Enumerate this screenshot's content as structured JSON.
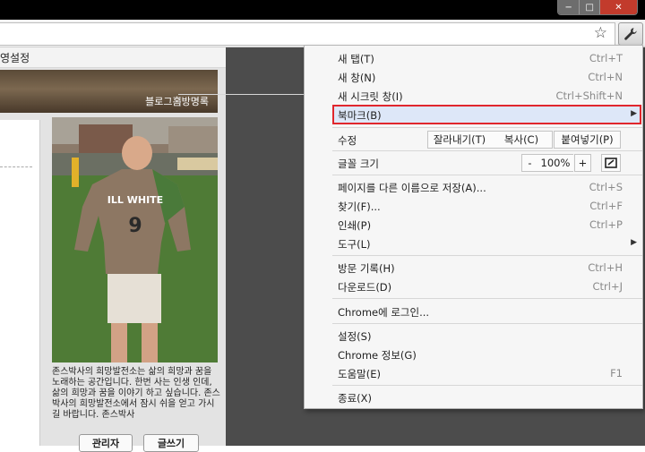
{
  "window": {
    "min": "−",
    "max": "□",
    "close": "✕"
  },
  "toolbar": {
    "star_icon": "star-icon",
    "wrench_icon": "wrench-icon"
  },
  "page": {
    "tab_strip_text": "영설정",
    "banner": {
      "link1": "블로그홈",
      "sep": "|",
      "link2": "방명록"
    },
    "photo": {
      "jersey_text": "ILL WHITE",
      "jersey_number": "9"
    },
    "caption": "존스박사의 희망발전소는 삶의 희망과 꿈을 노래하는 공간입니다. 한번 사는 인생 인데, 삶의 희망과 꿈을 이야기 하고 싶습니다. 존스박사의 희망발전소에서 잠시 쉬을 얻고 가시길 바랍니다. 존스박사",
    "btn_manage": "관리자",
    "btn_write": "글쓰기"
  },
  "menu": {
    "new_tab": {
      "label": "새 탭(T)",
      "shortcut": "Ctrl+T"
    },
    "new_window": {
      "label": "새 창(N)",
      "shortcut": "Ctrl+N"
    },
    "incognito": {
      "label": "새 시크릿 창(I)",
      "shortcut": "Ctrl+Shift+N"
    },
    "bookmarks": {
      "label": "북마크(B)",
      "arrow": "▶"
    },
    "edit": {
      "label": "수정",
      "cut": "잘라내기(T)",
      "copy": "복사(C)",
      "paste": "붙여넣기(P)"
    },
    "zoom": {
      "label": "글꼴 크기",
      "minus": "-",
      "value": "100%",
      "plus": "+"
    },
    "save_as": {
      "label": "페이지를 다른 이름으로 저장(A)...",
      "shortcut": "Ctrl+S"
    },
    "find": {
      "label": "찾기(F)...",
      "shortcut": "Ctrl+F"
    },
    "print": {
      "label": "인쇄(P)",
      "shortcut": "Ctrl+P"
    },
    "tools": {
      "label": "도구(L)",
      "arrow": "▶"
    },
    "history": {
      "label": "방문 기록(H)",
      "shortcut": "Ctrl+H"
    },
    "downloads": {
      "label": "다운로드(D)",
      "shortcut": "Ctrl+J"
    },
    "signin": {
      "label": "Chrome에 로그인..."
    },
    "settings": {
      "label": "설정(S)"
    },
    "about": {
      "label": "Chrome 정보(G)"
    },
    "help": {
      "label": "도움말(E)",
      "shortcut": "F1"
    },
    "exit": {
      "label": "종료(X)"
    }
  },
  "highlight_color": "#e0262d"
}
